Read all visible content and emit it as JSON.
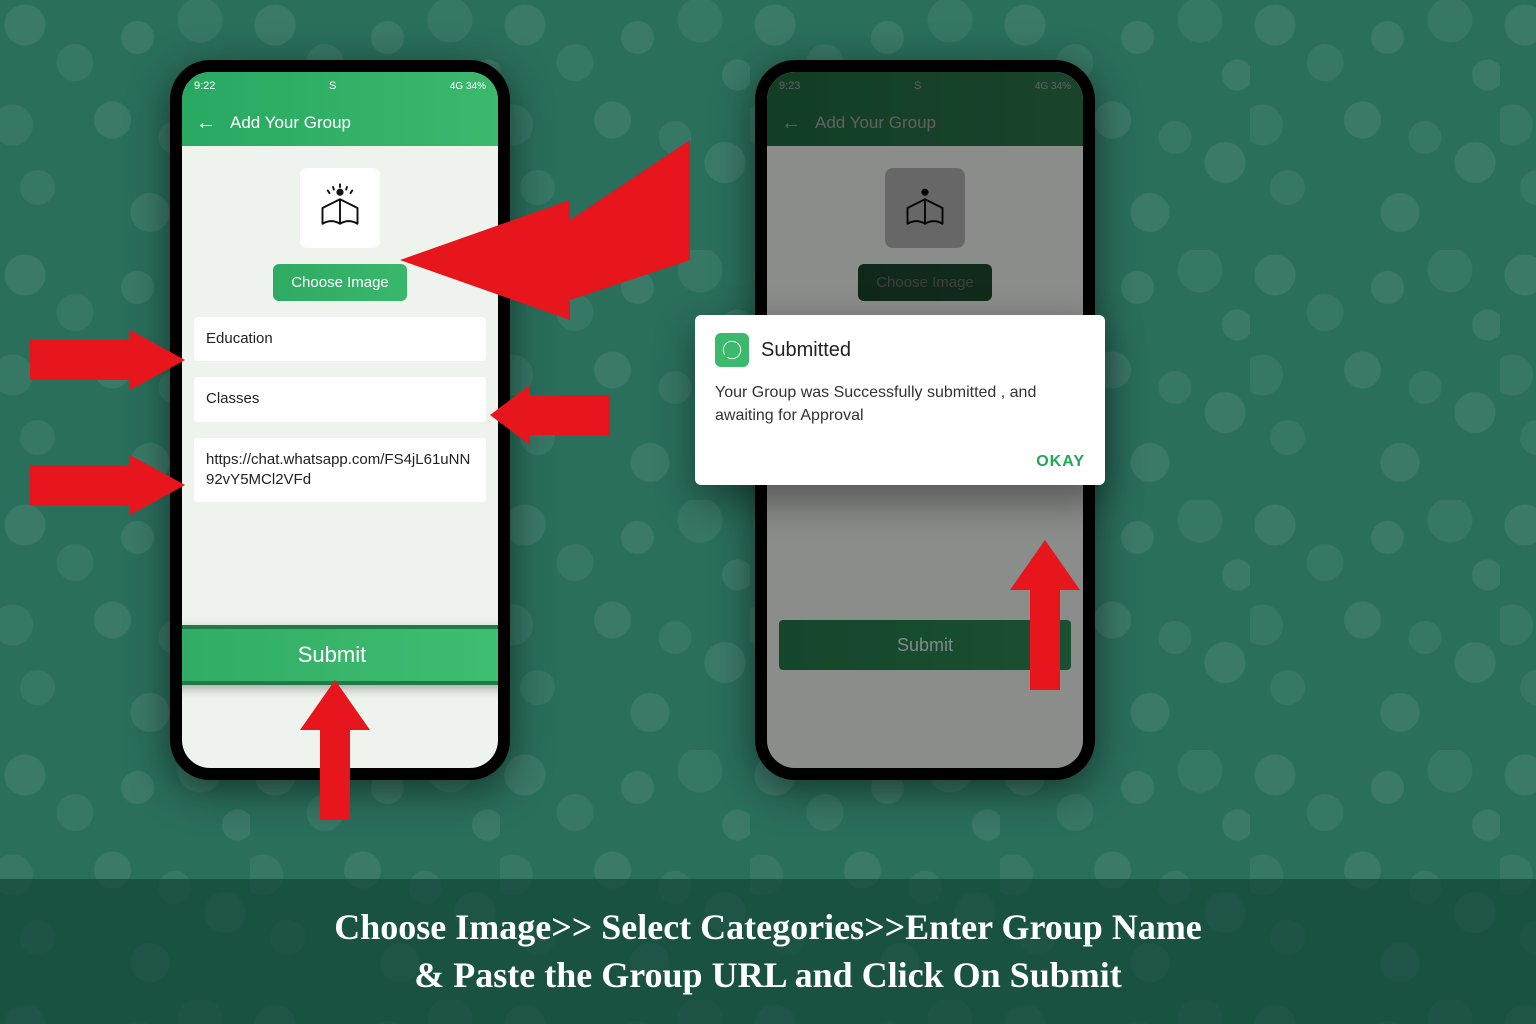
{
  "status": {
    "time_left": "9:22",
    "time_right": "9:23",
    "carrier_glyph": "S",
    "right_text": "4G  34%",
    "right_text2": "4G  34%"
  },
  "appbar": {
    "title": "Add Your Group"
  },
  "form": {
    "choose_image_label": "Choose Image",
    "category_value": "Education",
    "group_name_value": "Classes",
    "url_value": "https://chat.whatsapp.com/FS4jL61uNN92vY5MCl2VFd",
    "submit_label": "Submit"
  },
  "dialog": {
    "title": "Submitted",
    "body": "Your Group was Successfully submitted , and awaiting for Approval",
    "okay_label": "OKAY"
  },
  "caption": {
    "line1": "Choose Image>> Select Categories>>Enter Group Name",
    "line2": "& Paste the Group URL and Click On Submit"
  }
}
